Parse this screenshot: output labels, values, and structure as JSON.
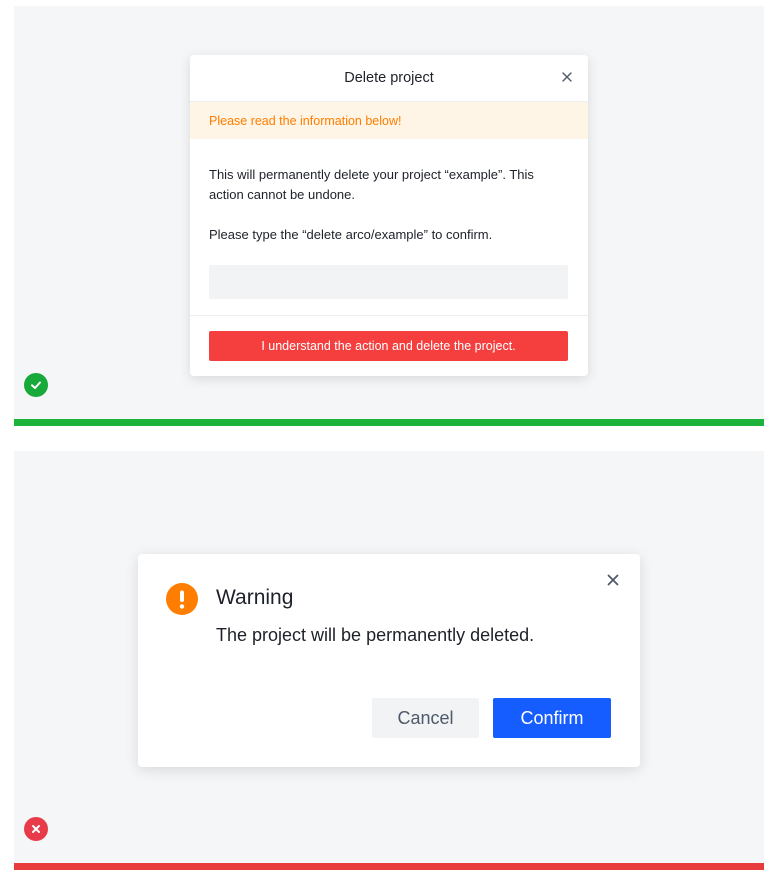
{
  "good_example": {
    "status_icon": "check-circle-icon",
    "status_color": "#1db33b",
    "modal": {
      "title": "Delete project",
      "close_icon": "close-icon",
      "alert": "Please read the information below!",
      "paragraph1": "This will permanently delete your project “example”. This action cannot be undone.",
      "paragraph2": "Please type the “delete arco/example” to confirm.",
      "input_value": "",
      "input_placeholder": "",
      "delete_button": "I understand the action and delete the project."
    }
  },
  "bad_example": {
    "status_icon": "x-circle-icon",
    "status_color": "#e83b3b",
    "modal": {
      "close_icon": "close-icon",
      "warning_icon": "exclamation-icon",
      "title": "Warning",
      "message": "The project will be permanently deleted.",
      "cancel_button": "Cancel",
      "confirm_button": "Confirm"
    }
  },
  "colors": {
    "primary": "#165dff",
    "danger": "#f53f3f",
    "warning": "#ff7d00"
  }
}
